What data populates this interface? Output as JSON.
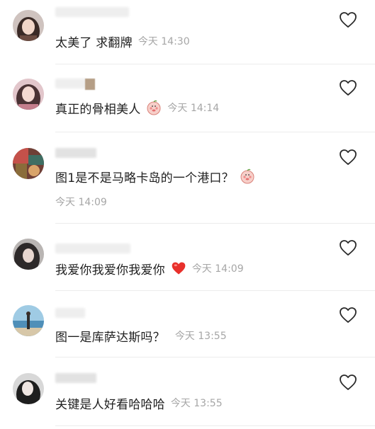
{
  "comments": [
    {
      "text": "太美了 求翻牌",
      "time": "今天 14:30",
      "avatar_icon": "avatar-woman-dark-hair-icon",
      "emoji": null
    },
    {
      "text": "真正的骨相美人",
      "time": "今天 14:14",
      "avatar_icon": "avatar-woman-pink-icon",
      "emoji": "blushing-piglet-emoji-icon"
    },
    {
      "text": "图1是不是马略卡岛的一个港口？",
      "time": "今天 14:09",
      "avatar_icon": "avatar-colorful-icon",
      "emoji": "blushing-piglet-emoji-icon"
    },
    {
      "text": "我爱你我爱你我爱你",
      "time": "今天 14:09",
      "avatar_icon": "avatar-woman-grey-icon",
      "emoji": "red-heart-emoji-icon"
    },
    {
      "text": "图一是库萨达斯吗？",
      "time": "今天 13:55",
      "avatar_icon": "avatar-beach-icon",
      "emoji": null
    },
    {
      "text": "关键是人好看哈哈哈",
      "time": "今天 13:55",
      "avatar_icon": "avatar-woman-bw-icon",
      "emoji": null
    }
  ],
  "colors": {
    "text": "#1f1f1f",
    "time": "#a6a6a6",
    "divider": "#ececec",
    "heart_outline": "#2a2a2a"
  },
  "icons": {
    "like": "heart-outline-icon"
  }
}
